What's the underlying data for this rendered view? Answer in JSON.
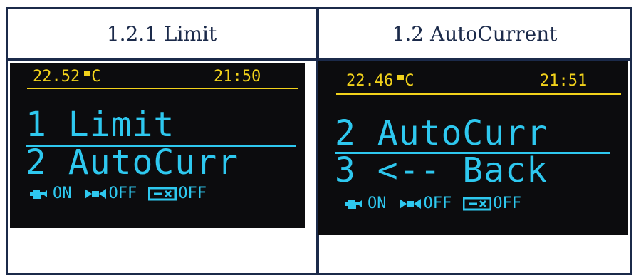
{
  "table": {
    "headers": [
      "1.2.1 Limit",
      "1.2 AutoCurrent"
    ]
  },
  "screens": [
    {
      "temperature": "22.52",
      "temp_unit": "C",
      "time": "21:50",
      "menu_items": [
        "1 Limit",
        "2 AutoCurr"
      ],
      "status_icons": [
        {
          "icon": "engine-icon",
          "label": "ON"
        },
        {
          "icon": "fan-icon",
          "label": "OFF"
        },
        {
          "icon": "pump-icon",
          "label": "OFF"
        }
      ]
    },
    {
      "temperature": "22.46",
      "temp_unit": "C",
      "time": "21:51",
      "menu_items": [
        "2 AutoCurr",
        "3 <-- Back"
      ],
      "status_icons": [
        {
          "icon": "engine-icon",
          "label": "ON"
        },
        {
          "icon": "fan-icon",
          "label": "OFF"
        },
        {
          "icon": "pump-icon",
          "label": "OFF"
        }
      ]
    }
  ],
  "colors": {
    "frame": "#1b2a4a",
    "oled_yellow": "#f2d21b",
    "oled_cyan": "#2ec8ef",
    "oled_bg": "#0c0c0e"
  }
}
